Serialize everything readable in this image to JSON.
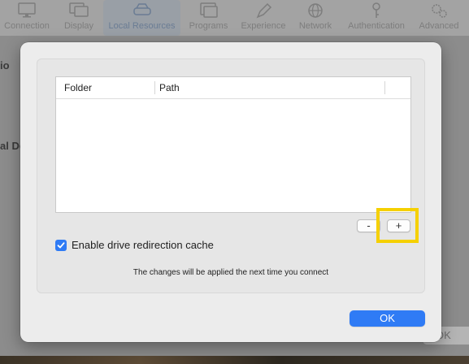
{
  "background": {
    "toolbar": [
      {
        "label": "Connection",
        "icon": "monitor-icon",
        "active": false
      },
      {
        "label": "Display",
        "icon": "displays-icon",
        "active": false
      },
      {
        "label": "Local Resources",
        "icon": "drive-icon",
        "active": true
      },
      {
        "label": "Programs",
        "icon": "windows-icon",
        "active": false
      },
      {
        "label": "Experience",
        "icon": "pen-icon",
        "active": false
      },
      {
        "label": "Network",
        "icon": "globe-icon",
        "active": false
      },
      {
        "label": "Authentication",
        "icon": "key-icon",
        "active": false
      },
      {
        "label": "Advanced",
        "icon": "gears-icon",
        "active": false
      }
    ],
    "side_text_1": "io",
    "side_text_2": "al De",
    "ok_label": "OK"
  },
  "dialog": {
    "table": {
      "columns": [
        "Folder",
        "Path"
      ],
      "rows": []
    },
    "remove_button": "-",
    "add_button": "+",
    "checkbox": {
      "label": "Enable drive redirection cache",
      "checked": true
    },
    "note": "The changes will be applied the next time you connect",
    "ok_button": "OK"
  },
  "colors": {
    "accent": "#2f7bf5",
    "highlight": "#f5d000"
  }
}
